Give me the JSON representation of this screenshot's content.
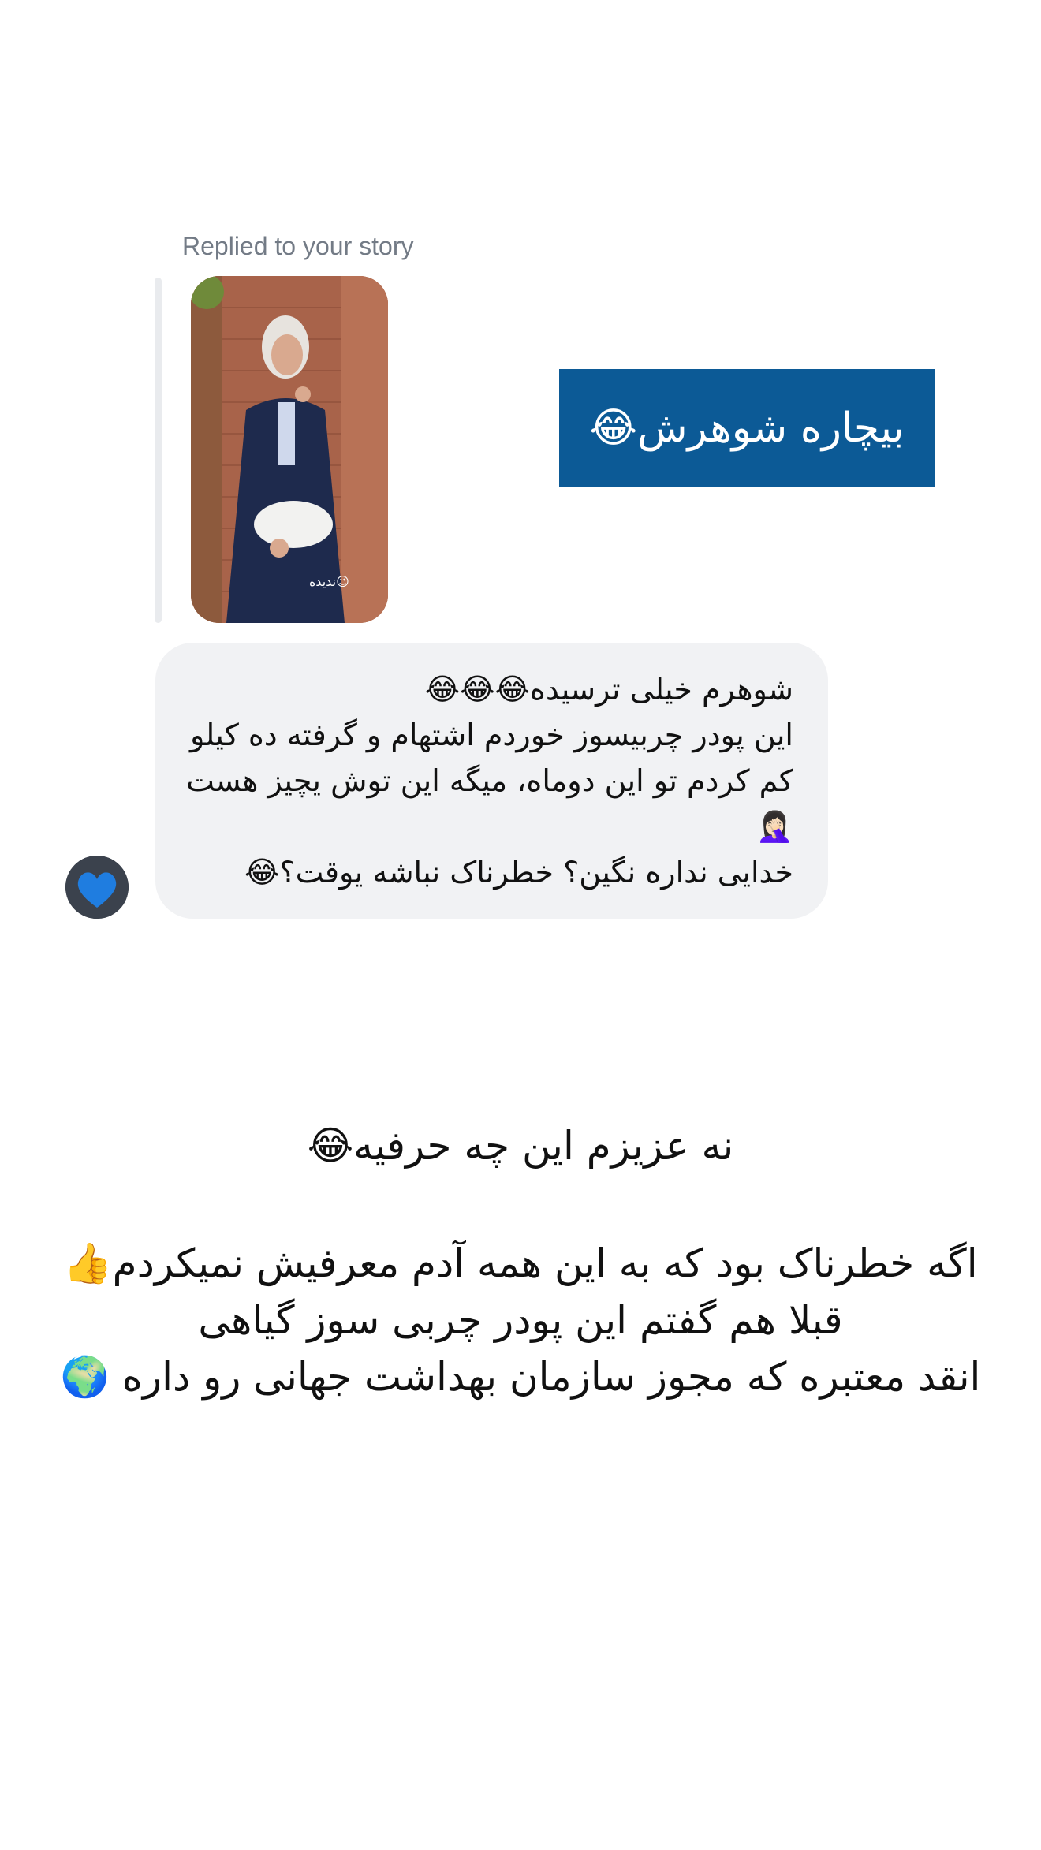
{
  "story_reply": {
    "label": "Replied to your story",
    "sticker_text": "بیچاره شوهرش😂",
    "thumbnail_caption": "😉ندیده"
  },
  "message": {
    "text": "شوهرم خیلی ترسیده😂😂😂\nاین پودر چربیسوز خوردم اشتهام و گرفته ده کیلو کم کردم تو این دوماه، میگه این توش یچیز هست🤦🏻‍♀️\nخدایی نداره نگین؟ خطرناک نباشه یوقت؟😂"
  },
  "caption": {
    "line1": "نه عزیزم این چه حرفیه😂",
    "body": "اگه خطرناک بود که به این همه آدم معرفیش نمیکردم👍\nقبلا هم گفتم این پودر چربی سوز گیاهی\nانقد معتبره که مجوز سازمان بهداشت جهانی رو داره 🌍"
  },
  "colors": {
    "sticker_bg": "#0c5a96",
    "bubble_bg": "#f1f2f4",
    "label_gray": "#737b86"
  }
}
